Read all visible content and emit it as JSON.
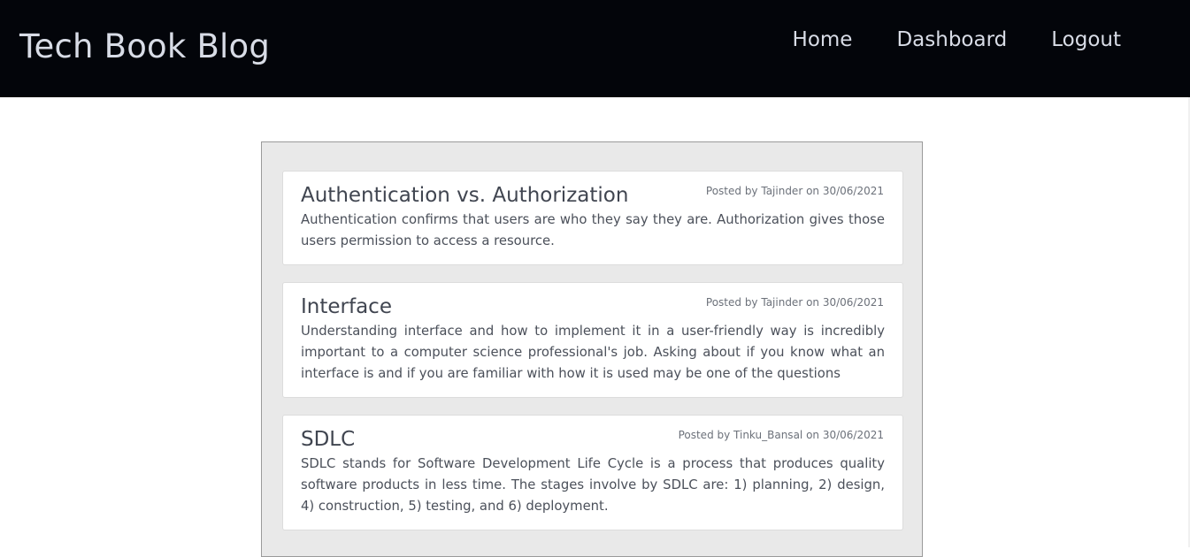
{
  "header": {
    "title": "Tech Book Blog",
    "nav": [
      {
        "label": "Home"
      },
      {
        "label": "Dashboard"
      },
      {
        "label": "Logout"
      }
    ]
  },
  "posts": [
    {
      "title": "Authentication vs. Authorization",
      "meta": "Posted by Tajinder on 30/06/2021",
      "body": "Authentication confirms that users are who they say they are. Authorization gives those users permission to access a resource."
    },
    {
      "title": "Interface",
      "meta": "Posted by Tajinder on 30/06/2021",
      "body": "Understanding interface and how to implement it in a user-friendly way is incredibly important to a computer science professional's job. Asking about if you know what an interface is and if you are familiar with how it is used may be one of the questions"
    },
    {
      "title": "SDLC",
      "meta": "Posted by Tinku_Bansal on 30/06/2021",
      "body": "SDLC stands for Software Development Life Cycle is a process that produces quality software products in less time. The stages involve by SDLC are: 1) planning, 2) design, 4) construction, 5) testing, and 6) deployment."
    }
  ]
}
